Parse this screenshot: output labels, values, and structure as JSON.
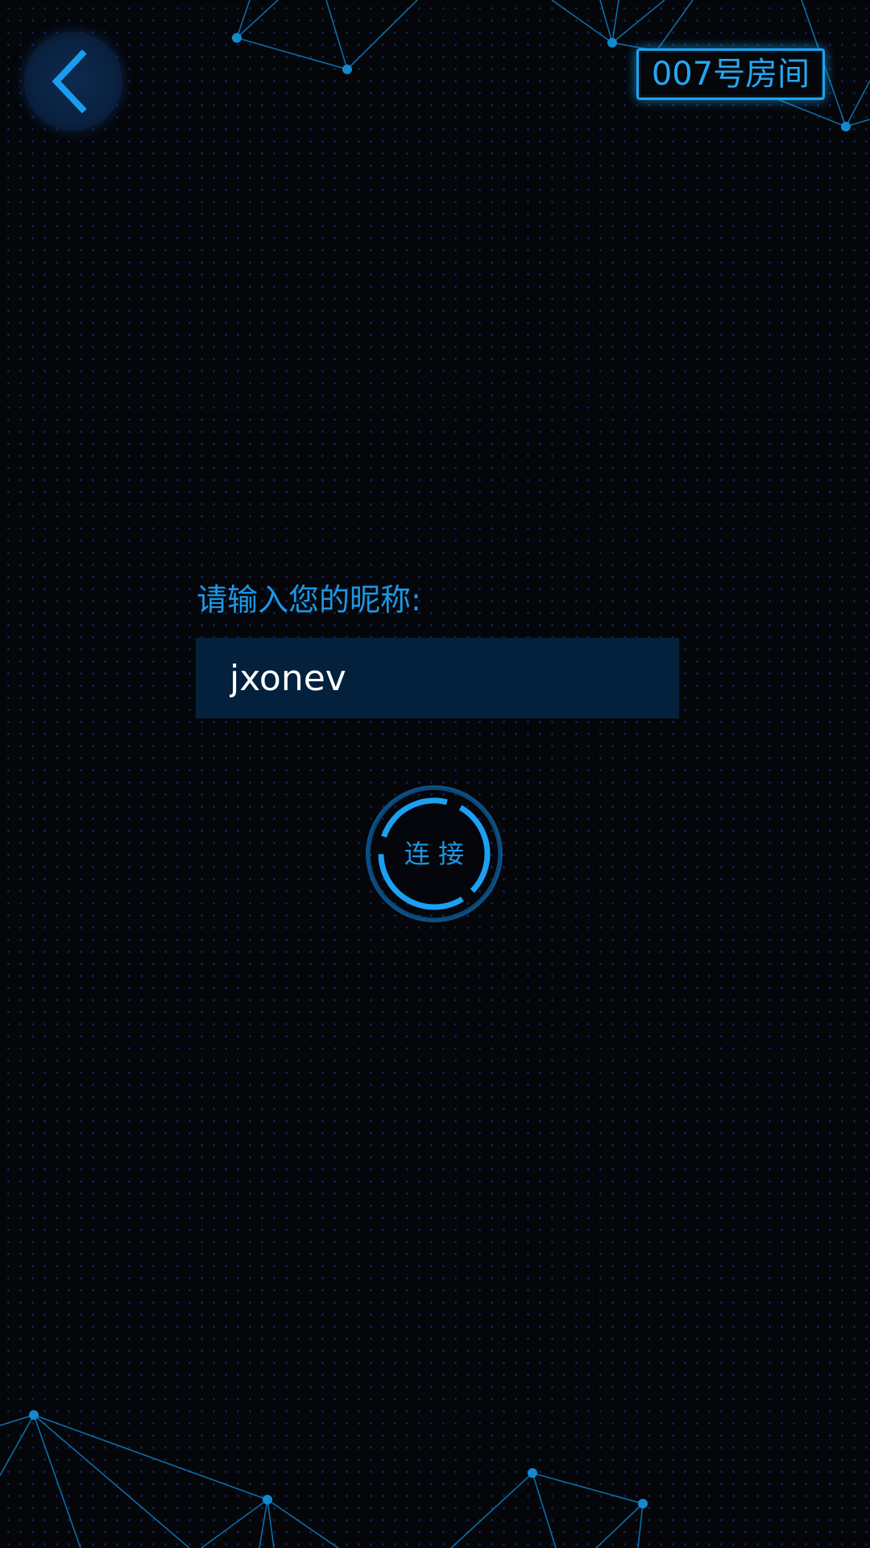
{
  "header": {
    "back_icon": "chevron-left-icon",
    "room_title": "007号房间"
  },
  "form": {
    "nickname_label": "请输入您的昵称:",
    "nickname_value": "jxonev"
  },
  "connect": {
    "label": "连 接",
    "icon": "ring-icon"
  },
  "colors": {
    "background": "#050609",
    "accent": "#1fa3ee",
    "input_background": "#03213d",
    "network_lines": "#0d7fc4"
  }
}
